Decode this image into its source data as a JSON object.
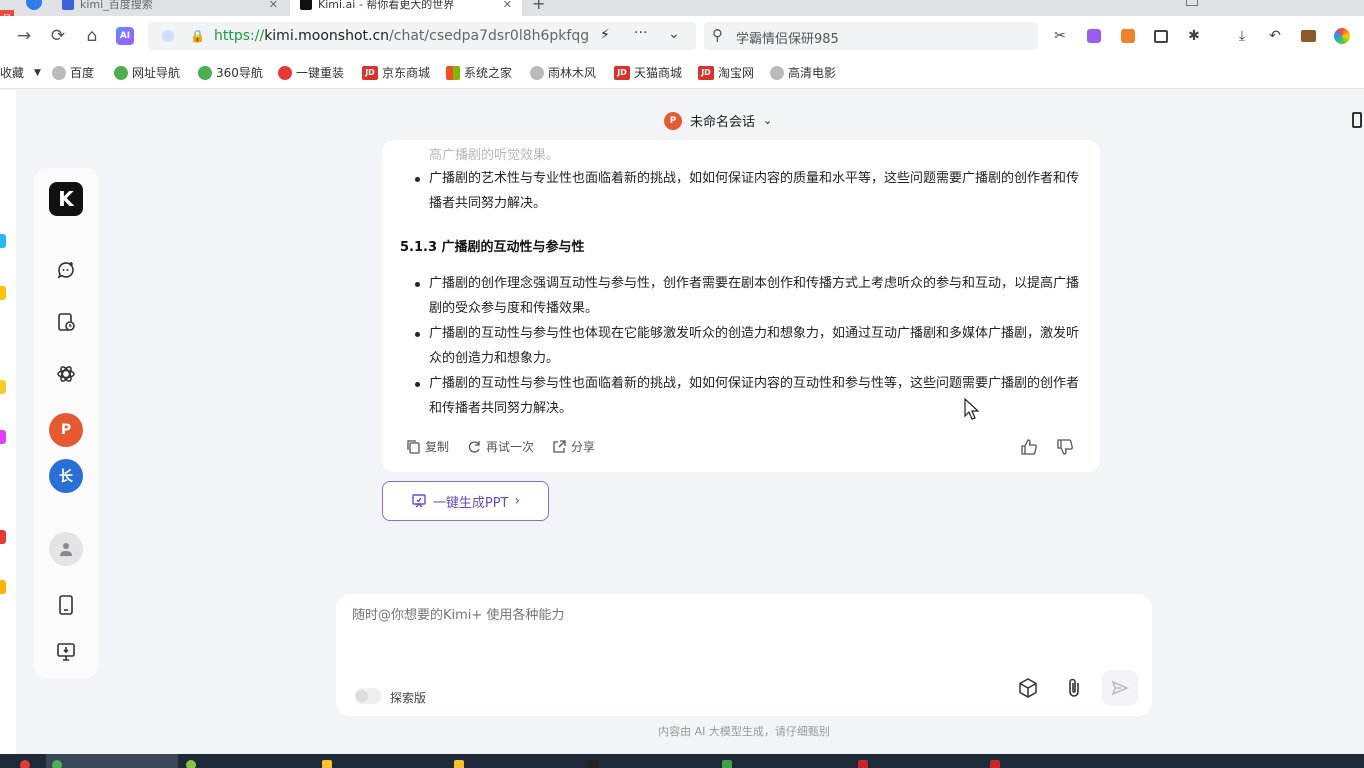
{
  "browser": {
    "badge": "号",
    "tabs": [
      {
        "title": "kimi_百度搜索"
      },
      {
        "title": "Kimi.ai - 帮你看更大的世界"
      }
    ],
    "url_scheme": "https://",
    "url_host": "kimi.moonshot.cn",
    "url_path": "/chat/csedpa7dsr0l8h6pkfqg",
    "search_text": "学霸情侣保研985",
    "ai_badge": "AI"
  },
  "bookmarks": {
    "items": [
      {
        "label": "收藏",
        "icon": "star-icon"
      },
      {
        "label": "百度",
        "icon": "globe-icon"
      },
      {
        "label": "网址导航",
        "icon": "nav-icon"
      },
      {
        "label": "360导航",
        "icon": "nav-icon"
      },
      {
        "label": "一键重装",
        "icon": "tomato-icon"
      },
      {
        "label": "京东商城",
        "icon": "jd-icon"
      },
      {
        "label": "系统之家",
        "icon": "windows-icon"
      },
      {
        "label": "雨林木风",
        "icon": "globe-icon"
      },
      {
        "label": "天猫商城",
        "icon": "jd-icon"
      },
      {
        "label": "淘宝网",
        "icon": "jd-icon"
      },
      {
        "label": "高清电影",
        "icon": "globe-icon"
      }
    ],
    "jd_text": "JD"
  },
  "header": {
    "conversation_title": "未命名会话",
    "ppt_icon_text": "P"
  },
  "sidebar": {
    "logo_text": "K",
    "app_ppt_text": "P",
    "app_long_text": "长"
  },
  "answer": {
    "faded_line": "高广播剧的听觉效果。",
    "bullets_top": [
      "广播剧的艺术性与专业性也面临着新的挑战，如如何保证内容的质量和水平等，这些问题需要广播剧的创作者和传播者共同努力解决。"
    ],
    "section_title": "5.1.3 广播剧的互动性与参与性",
    "bullets": [
      "广播剧的创作理念强调互动性与参与性，创作者需要在剧本创作和传播方式上考虑听众的参与和互动，以提高广播剧的受众参与度和传播效果。",
      "广播剧的互动性与参与性也体现在它能够激发听众的创造力和想象力，如通过互动广播剧和多媒体广播剧，激发听众的创造力和想象力。",
      "广播剧的互动性与参与性也面临着新的挑战，如如何保证内容的互动性和参与性等，这些问题需要广播剧的创作者和传播者共同努力解决。"
    ],
    "actions": {
      "copy": "复制",
      "retry": "再试一次",
      "share": "分享"
    }
  },
  "ppt_button": {
    "label": "一键生成PPT"
  },
  "input": {
    "placeholder": "随时@你想要的Kimi+ 使用各种能力",
    "toggle_label": "探索版"
  },
  "footer": {
    "disclaimer": "内容由 AI 大模型生成，请仔细甄别"
  },
  "colors": {
    "accent": "#6b49c8",
    "ppt_orange": "#e65a32",
    "long_blue": "#2a6fd6",
    "url_green": "#1a9c3e"
  }
}
